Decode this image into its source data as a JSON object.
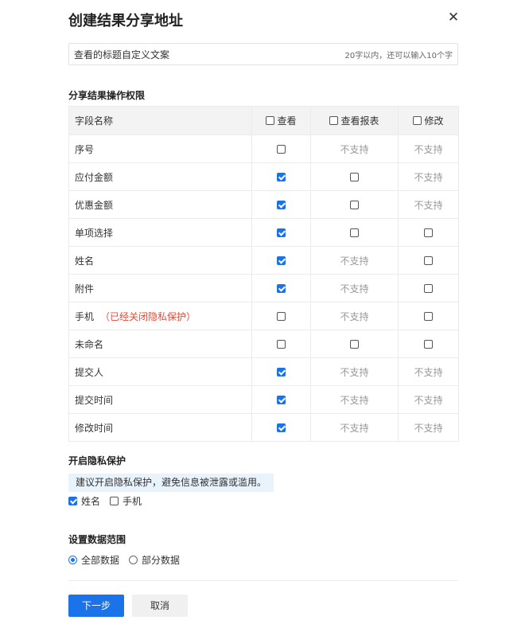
{
  "dialog": {
    "title": "创建结果分享地址",
    "close_icon": "close-icon"
  },
  "title_input": {
    "value": "查看的标题自定义文案",
    "hint": "20字以内，还可以输入10个字"
  },
  "permissions": {
    "section_title": "分享结果操作权限",
    "headers": {
      "field_name": "字段名称",
      "view": "查看",
      "view_report": "查看报表",
      "modify": "修改",
      "view_checked": false,
      "view_report_checked": false,
      "modify_checked": false
    },
    "rows": [
      {
        "name": "序号",
        "note": "",
        "view": false,
        "view_report": "不支持",
        "modify": "不支持"
      },
      {
        "name": "应付金额",
        "note": "",
        "view": true,
        "view_report": false,
        "modify": "不支持"
      },
      {
        "name": "优惠金额",
        "note": "",
        "view": true,
        "view_report": false,
        "modify": "不支持"
      },
      {
        "name": "单项选择",
        "note": "",
        "view": true,
        "view_report": false,
        "modify": false
      },
      {
        "name": "姓名",
        "note": "",
        "view": true,
        "view_report": "不支持",
        "modify": false
      },
      {
        "name": "附件",
        "note": "",
        "view": true,
        "view_report": "不支持",
        "modify": false
      },
      {
        "name": "手机",
        "note": "（已经关闭隐私保护）",
        "view": false,
        "view_report": "不支持",
        "modify": false
      },
      {
        "name": "未命名",
        "note": "",
        "view": false,
        "view_report": false,
        "modify": false
      },
      {
        "name": "提交人",
        "note": "",
        "view": true,
        "view_report": "不支持",
        "modify": "不支持"
      },
      {
        "name": "提交时间",
        "note": "",
        "view": true,
        "view_report": "不支持",
        "modify": "不支持"
      },
      {
        "name": "修改时间",
        "note": "",
        "view": true,
        "view_report": "不支持",
        "modify": "不支持"
      }
    ]
  },
  "privacy": {
    "section_title": "开启隐私保护",
    "tip": "建议开启隐私保护，避免信息被泄露或滥用。",
    "options": [
      {
        "label": "姓名",
        "checked": true
      },
      {
        "label": "手机",
        "checked": false
      }
    ]
  },
  "data_range": {
    "section_title": "设置数据范围",
    "options": [
      {
        "label": "全部数据",
        "selected": true
      },
      {
        "label": "部分数据",
        "selected": false
      }
    ]
  },
  "footer": {
    "next_label": "下一步",
    "cancel_label": "取消"
  },
  "colors": {
    "accent": "#1a73e8",
    "warning": "#e64b3b",
    "tip_bg": "#e8f3fc"
  }
}
